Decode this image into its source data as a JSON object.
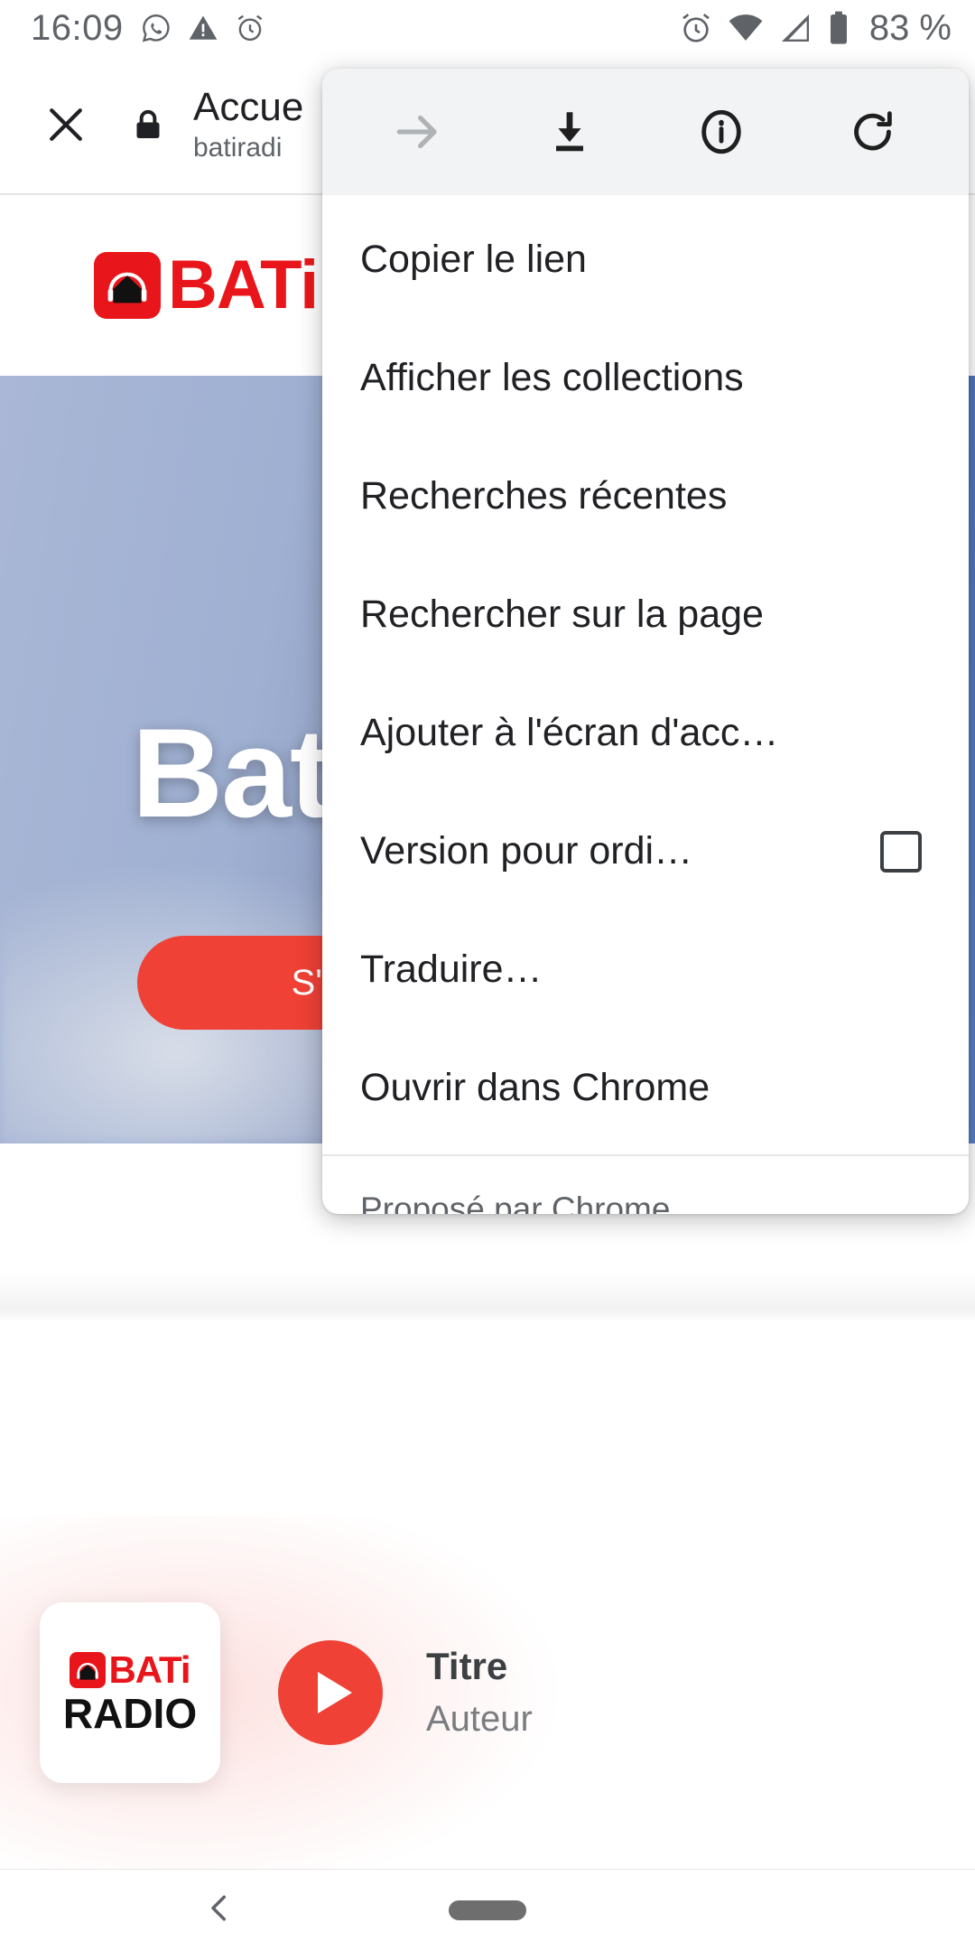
{
  "status_bar": {
    "time": "16:09",
    "battery_text": "83 %",
    "left_icons": [
      "whatsapp-icon",
      "warning-icon",
      "alarm-icon"
    ],
    "right_icons": [
      "alarm-icon",
      "wifi-icon",
      "signal-icon",
      "battery-icon"
    ]
  },
  "browser_bar": {
    "close_icon": "close-icon",
    "lock_icon": "lock-icon",
    "title": "Accue",
    "url": "batiradi"
  },
  "site": {
    "logo_text": "BATi",
    "hero_title": "Bat",
    "cta_label": "S'ab"
  },
  "menu": {
    "toolbar": [
      {
        "name": "forward-icon",
        "label": "Suivant",
        "disabled": true
      },
      {
        "name": "download-icon",
        "label": "Télécharger",
        "disabled": false
      },
      {
        "name": "info-icon",
        "label": "Informations sur la page",
        "disabled": false
      },
      {
        "name": "reload-icon",
        "label": "Actualiser",
        "disabled": false
      }
    ],
    "items": [
      {
        "label": "Copier le lien",
        "checkbox": false
      },
      {
        "label": "Afficher les collections",
        "checkbox": false
      },
      {
        "label": "Recherches récentes",
        "checkbox": false
      },
      {
        "label": "Rechercher sur la page",
        "checkbox": false
      },
      {
        "label": "Ajouter à l'écran d'acc…",
        "checkbox": false
      },
      {
        "label": "Version pour ordi…",
        "checkbox": true,
        "checked": false
      },
      {
        "label": "Traduire…",
        "checkbox": false
      },
      {
        "label": "Ouvrir dans Chrome",
        "checkbox": false
      }
    ],
    "footer": "Proposé par Chrome"
  },
  "player": {
    "logo_bati": "BATi",
    "logo_radio": "RADIO",
    "play_icon": "play-icon",
    "title": "Titre",
    "author": "Auteur"
  },
  "nav_bar": {
    "back_icon": "back-icon",
    "home_icon": "home-pill"
  },
  "colors": {
    "brand_red": "#E8161A",
    "accent_red": "#EF4136",
    "menu_toolbar_bg": "#f1f3f4",
    "text_primary": "#202124",
    "text_secondary": "#5f6368"
  }
}
